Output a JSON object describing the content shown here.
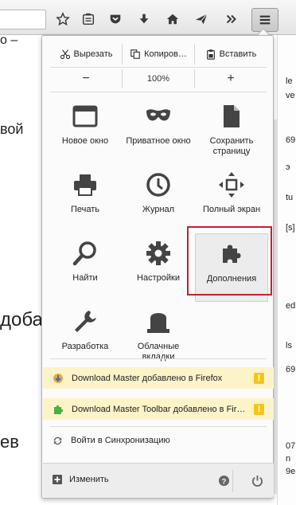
{
  "background_page": {
    "fragments": [
      "о –",
      "вой",
      "доба",
      "ев"
    ],
    "right_fragments": [
      "le",
      "ve",
      "69",
      "э",
      "tu",
      "[s]",
      "ed",
      "ls",
      "69",
      "07",
      "n",
      "9e"
    ]
  },
  "toolbar": {
    "icons": [
      "bookmark-star-icon",
      "reading-list-icon",
      "pocket-icon",
      "download-icon",
      "home-icon",
      "send-icon",
      "overflow-icon",
      "hamburger-menu-icon"
    ]
  },
  "menu": {
    "edit": {
      "cut": "Вырезать",
      "copy": "Копиров…",
      "paste": "Вставить"
    },
    "zoom": {
      "minus": "−",
      "value": "100%",
      "plus": "+"
    },
    "items": [
      {
        "label": "Новое окно",
        "icon": "new-window-icon"
      },
      {
        "label": "Приватное окно",
        "icon": "private-mask-icon"
      },
      {
        "label": "Сохранить страницу",
        "icon": "save-page-icon"
      },
      {
        "label": "Печать",
        "icon": "printer-icon"
      },
      {
        "label": "Журнал",
        "icon": "history-clock-icon"
      },
      {
        "label": "Полный экран",
        "icon": "fullscreen-icon"
      },
      {
        "label": "Найти",
        "icon": "search-icon"
      },
      {
        "label": "Настройки",
        "icon": "gear-icon"
      },
      {
        "label": "Дополнения",
        "icon": "puzzle-icon"
      },
      {
        "label": "Разработка",
        "icon": "wrench-icon"
      },
      {
        "label": "Облачные вкладки",
        "icon": "cloud-tabs-icon"
      }
    ],
    "notifications": [
      {
        "text": "Download Master добавлено в Firefox",
        "warn": "!"
      },
      {
        "text": "Download Master Toolbar добавлено в Firefox",
        "warn": "!"
      }
    ],
    "sync": "Войти в Синхронизацию",
    "footer": {
      "change": "Изменить"
    }
  },
  "colors": {
    "highlight_border": "#c8202b",
    "notif_bg": "#fdf3c9",
    "warn": "#f5c518",
    "puzzle": "#4cae3d"
  }
}
